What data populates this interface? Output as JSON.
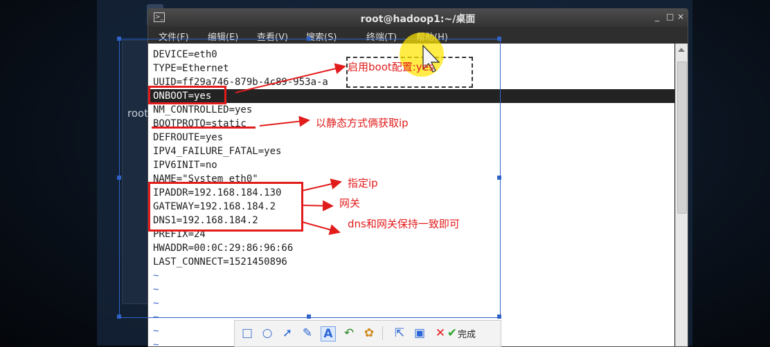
{
  "desktop": {
    "background_text": "root"
  },
  "window": {
    "title": "root@hadoop1:~/桌面",
    "controls": [
      "_",
      "□",
      "×"
    ],
    "menu": [
      "文件(F)",
      "编辑(E)",
      "查看(V)",
      "搜索(S)",
      "终端(T)",
      "帮助(H)"
    ]
  },
  "terminal": {
    "lines": [
      "DEVICE=eth0",
      "TYPE=Ethernet",
      "UUID=ff29a746-879b-4c89-953a-a",
      "ONBOOT=yes",
      "NM_CONTROLLED=yes",
      "BOOTPROTO=static",
      "DEFROUTE=yes",
      "IPV4_FAILURE_FATAL=yes",
      "IPV6INIT=no",
      "NAME=\"System eth0\"",
      "IPADDR=192.168.184.130",
      "GATEWAY=192.168.184.2",
      "DNS1=192.168.184.2",
      "PREFIX=24",
      "HWADDR=00:0C:29:86:96:66",
      "LAST_CONNECT=1521450896",
      "~",
      "~",
      "~",
      "~",
      "~",
      "~"
    ]
  },
  "annotations": {
    "onboot": "启用boot配置:yes",
    "bootproto": "以静态方式俩获取ip",
    "ipaddr": "指定ip",
    "gateway": "网关",
    "dns": "dns和网关保持一致即可"
  },
  "toolbar": {
    "icons": [
      "rectangle-icon",
      "ellipse-icon",
      "arrow-icon",
      "pen-icon",
      "text-icon",
      "undo-icon",
      "color-palette-icon",
      "share-icon",
      "save-icon",
      "cancel-icon",
      "confirm-icon"
    ],
    "done_label": "完成"
  },
  "colors": {
    "annotation": "#e21b1b",
    "selection": "#2f63c9",
    "terminal_bg": "#ffffff",
    "highlight_line": "#232323"
  }
}
